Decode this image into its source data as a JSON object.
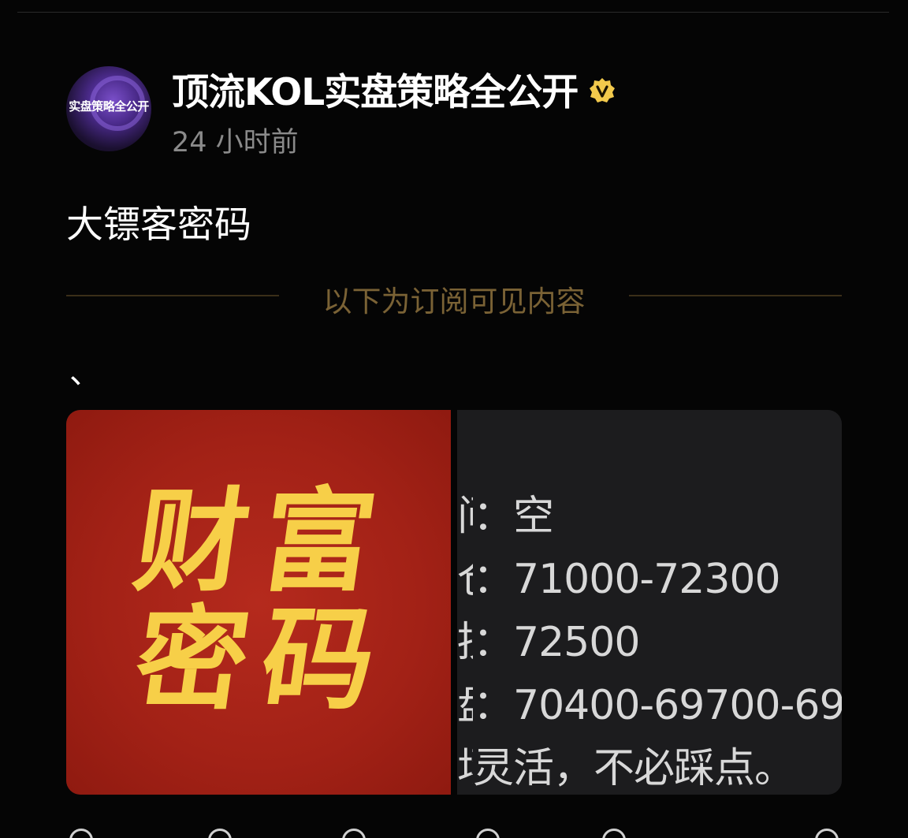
{
  "author": {
    "avatar_text": "实盘策略全公开",
    "name": "顶流KOL实盘策略全公开",
    "verified_icon": "verified-badge-icon",
    "badge_color": "#f2c94c"
  },
  "post": {
    "timestamp": "24 小时前",
    "title": "大镖客密码",
    "subscriber_divider_label": "以下为订阅可见内容",
    "body_text": "、"
  },
  "image_card": {
    "left_panel": {
      "chars": [
        "财",
        "富",
        "密",
        "码"
      ],
      "bg_color": "#a22116",
      "text_color": "#f7cf48"
    },
    "right_panel": {
      "lines": [
        {
          "prefix": "问",
          "text": "：空"
        },
        {
          "prefix": "仓",
          "text": "：71000-72300"
        },
        {
          "prefix": "损",
          "text": "：72500"
        },
        {
          "prefix": "盘",
          "text": "：70400-69700-69"
        },
        {
          "prefix": "场",
          "text": "灵活，不必踩点。"
        }
      ]
    }
  },
  "action_bar": {
    "icons": [
      "like-icon",
      "comment-icon",
      "share-icon",
      "repost-icon",
      "more-icon",
      "tip-icon"
    ]
  },
  "colors": {
    "background": "#050505",
    "divider_gold": "#7a6235",
    "timestamp_gray": "#8a8a8a"
  }
}
